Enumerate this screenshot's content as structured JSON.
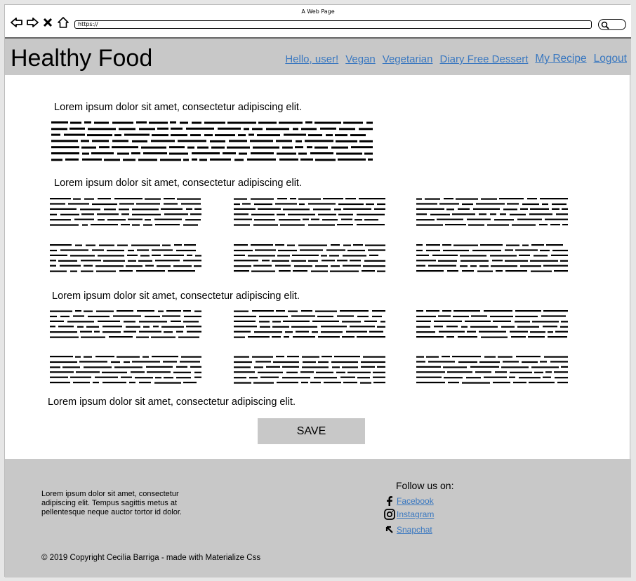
{
  "window": {
    "title": "A Web Page",
    "address": "https://"
  },
  "header": {
    "brand": "Healthy Food",
    "nav": [
      "Hello, user!",
      "Vegan",
      "Vegetarian",
      "Diary Free Dessert",
      "My Recipe",
      "Logout"
    ]
  },
  "content": {
    "section_headings": [
      "Lorem ipsum dolor sit amet, consectetur adipiscing elit.",
      "Lorem ipsum dolor sit amet, consectetur adipiscing elit.",
      "Lorem ipsum dolor sit amet, consectetur adipiscing elit.",
      "Lorem ipsum dolor sit amet, consectetur adipiscing elit."
    ],
    "save_label": "SAVE"
  },
  "footer": {
    "about": "Lorem ipsum dolor sit amet, consectetur adipiscing elit. Tempus sagittis metus at pellentesque neque auctor tortor id dolor.",
    "follow_title": "Follow us on:",
    "social": [
      {
        "label": "Facebook",
        "icon": "facebook-icon"
      },
      {
        "label": "Instagram",
        "icon": "instagram-icon"
      },
      {
        "label": "Snapchat",
        "icon": "snapchat-icon"
      }
    ],
    "copyright": "© 2019 Copyright Cecilia Barriga - made with Materialize Css"
  },
  "colors": {
    "header_bg": "#c8c8c8",
    "link": "#3a78c0",
    "page_bg": "#e6e6e6"
  }
}
